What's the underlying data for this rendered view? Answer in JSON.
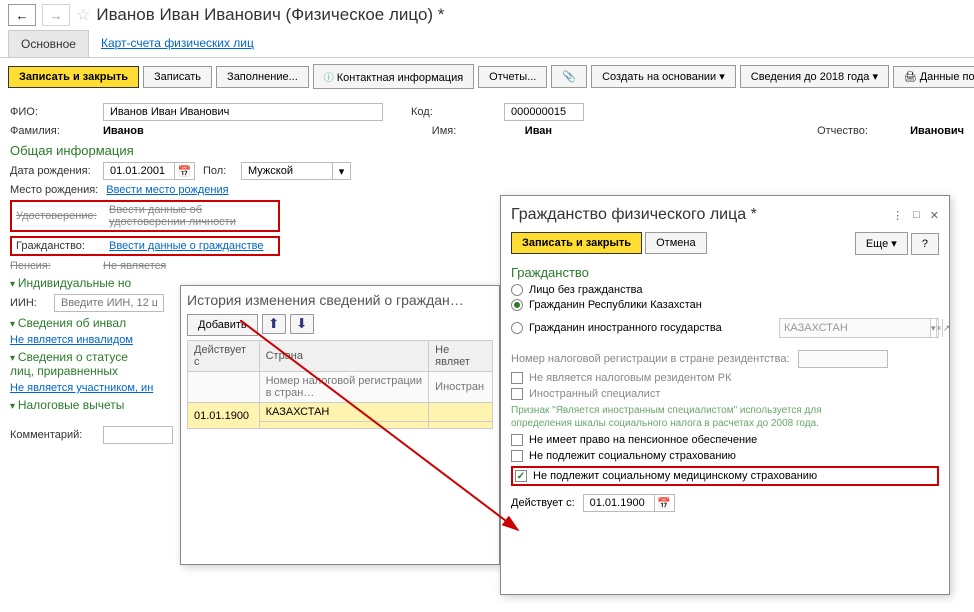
{
  "header": {
    "title": "Иванов Иван Иванович (Физическое лицо) *"
  },
  "tabs": {
    "main": "Основное",
    "card": "Карт-счета физических лиц"
  },
  "toolbar": {
    "save_close": "Записать и закрыть",
    "save": "Записать",
    "fill": "Заполнение...",
    "contact": "Контактная информация",
    "reports": "Отчеты...",
    "create_from": "Создать на основании",
    "legacy": "Сведения до 2018 года",
    "person_data": "Данные по физическому лицу"
  },
  "form": {
    "fio_label": "ФИО:",
    "fio_value": "Иванов Иван Иванович",
    "code_label": "Код:",
    "code_value": "000000015",
    "fam_label": "Фамилия:",
    "fam_value": "Иванов",
    "name_label": "Имя:",
    "name_value": "Иван",
    "mid_label": "Отчество:",
    "mid_value": "Иванович",
    "section_general": "Общая информация",
    "birth_label": "Дата рождения:",
    "birth_value": "01.01.2001",
    "sex_label": "Пол:",
    "sex_value": "Мужской",
    "birthplace_label": "Место рождения:",
    "birthplace_link": "Ввести место рождения",
    "cert_label": "Удостоверение:",
    "cert_link": "Ввести данные об удостоверении личности",
    "citizenship_label": "Гражданство:",
    "citizenship_link": "Ввести данные о гражданстве",
    "pension_label": "Пенсия:",
    "pension_link": "Не является",
    "ind_header": "Индивидуальные но",
    "iin_label": "ИИН:",
    "iin_placeholder": "Введите ИИН, 12 ц",
    "inv_header": "Сведения об инвал",
    "inv_link": "Не является инвалидом",
    "status_header": "Сведения о статусе\nлиц, приравненных",
    "status_link": "Не является участником, ин",
    "tax_header": "Налоговые вычеты",
    "comment_label": "Комментарий:"
  },
  "modal1": {
    "title": "История изменения сведений о граждан…",
    "add": "Добавить",
    "col_from": "Действует с",
    "col_country": "Страна",
    "col_notres": "Не являет",
    "sub_taxnum": "Номер налоговой регистрации в стран…",
    "sub_foreign": "Иностран",
    "row_date": "01.01.1900",
    "row_country": "КАЗАХСТАН"
  },
  "modal2": {
    "title": "Гражданство физического лица *",
    "save_close": "Записать и закрыть",
    "cancel": "Отмена",
    "more": "Еще",
    "section": "Гражданство",
    "r1": "Лицо без гражданства",
    "r2": "Гражданин Республики Казахстан",
    "r3": "Гражданин иностранного государства",
    "country_val": "КАЗАХСТАН",
    "taxnum_label": "Номер налоговой регистрации в стране резидентства:",
    "c1": "Не является налоговым резидентом РК",
    "c2": "Иностранный специалист",
    "hint": "Признак \"Является иностранным специалистом\" используется для\nопределения шкалы социального налога в расчетах до 2008 года.",
    "c3": "Не имеет право на пенсионное обеспечение",
    "c4": "Не подлежит социальному страхованию",
    "c5": "Не подлежит социальному медицинскому страхованию",
    "from_label": "Действует с:",
    "from_value": "01.01.1900"
  }
}
